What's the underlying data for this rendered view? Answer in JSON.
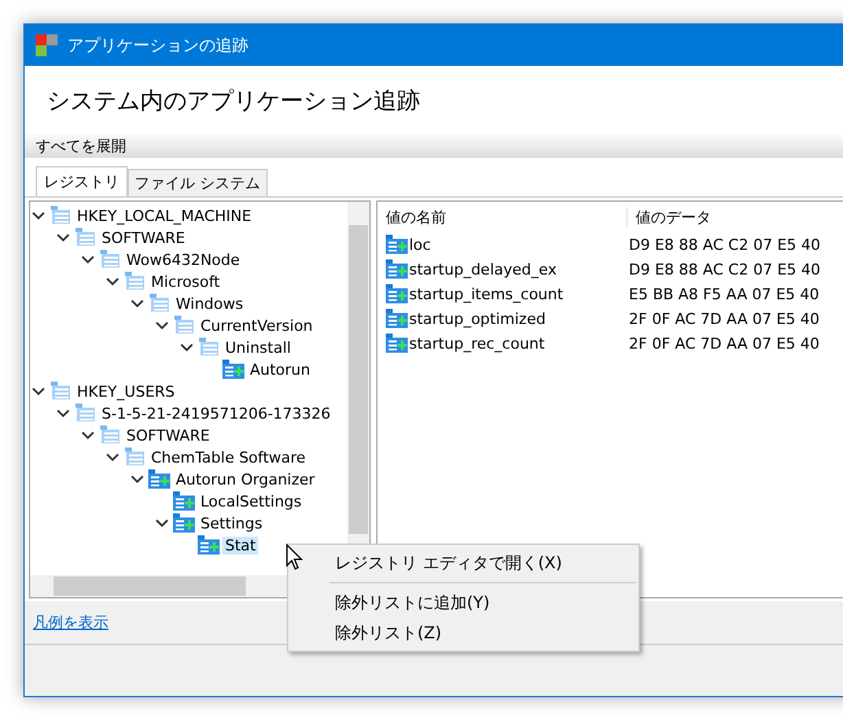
{
  "window": {
    "title": "アプリケーションの追跡"
  },
  "heading": "システム内のアプリケーション追跡",
  "toolbar": {
    "button": "すべてを展開"
  },
  "tabs": [
    {
      "label": "レジストリ",
      "selected": true
    },
    {
      "label": "ファイル システム",
      "selected": false
    }
  ],
  "tree": [
    {
      "label": "HKEY_LOCAL_MACHINE",
      "kind": "key",
      "expanded": true,
      "selected": false,
      "children": [
        {
          "label": "SOFTWARE",
          "kind": "key",
          "expanded": true,
          "selected": false,
          "children": [
            {
              "label": "Wow6432Node",
              "kind": "key",
              "expanded": true,
              "selected": false,
              "children": [
                {
                  "label": "Microsoft",
                  "kind": "key",
                  "expanded": true,
                  "selected": false,
                  "children": [
                    {
                      "label": "Windows",
                      "kind": "key",
                      "expanded": true,
                      "selected": false,
                      "children": [
                        {
                          "label": "CurrentVersion",
                          "kind": "key",
                          "expanded": true,
                          "selected": false,
                          "children": [
                            {
                              "label": "Uninstall",
                              "kind": "key",
                              "expanded": true,
                              "selected": false,
                              "children": [
                                {
                                  "label": "Autorun",
                                  "kind": "tracked",
                                  "selected": false
                                }
                              ]
                            }
                          ]
                        }
                      ]
                    }
                  ]
                }
              ]
            }
          ]
        }
      ]
    },
    {
      "label": "HKEY_USERS",
      "kind": "key",
      "expanded": true,
      "selected": false,
      "children": [
        {
          "label": "S-1-5-21-2419571206-173326",
          "kind": "key",
          "expanded": true,
          "selected": false,
          "children": [
            {
              "label": "SOFTWARE",
              "kind": "key",
              "expanded": true,
              "selected": false,
              "children": [
                {
                  "label": "ChemTable Software",
                  "kind": "key",
                  "expanded": true,
                  "selected": false,
                  "children": [
                    {
                      "label": "Autorun Organizer",
                      "kind": "tracked",
                      "expanded": true,
                      "selected": false,
                      "children": [
                        {
                          "label": "LocalSettings",
                          "kind": "tracked",
                          "selected": false
                        },
                        {
                          "label": "Settings",
                          "kind": "tracked",
                          "expanded": true,
                          "selected": false,
                          "children": [
                            {
                              "label": "Stat",
                              "kind": "tracked",
                              "selected": true
                            }
                          ]
                        }
                      ]
                    }
                  ]
                }
              ]
            }
          ]
        }
      ]
    }
  ],
  "table": {
    "columns": [
      "値の名前",
      "値のデータ"
    ],
    "rows": [
      {
        "name": "loc",
        "data": "D9 E8 88 AC C2 07 E5 40"
      },
      {
        "name": "startup_delayed_ex",
        "data": "D9 E8 88 AC C2 07 E5 40"
      },
      {
        "name": "startup_items_count",
        "data": "E5 BB A8 F5 AA 07 E5 40"
      },
      {
        "name": "startup_optimized",
        "data": "2F 0F AC 7D AA 07 E5 40"
      },
      {
        "name": "startup_rec_count",
        "data": "2F 0F AC 7D AA 07 E5 40"
      }
    ]
  },
  "legend_link": "凡例を表示",
  "context_menu": [
    {
      "label": "レジストリ エディタで開く(X)",
      "kind": "item"
    },
    {
      "kind": "separator"
    },
    {
      "label": "除外リストに追加(Y)",
      "kind": "item"
    },
    {
      "label": "除外リスト(Z)",
      "kind": "item"
    }
  ]
}
